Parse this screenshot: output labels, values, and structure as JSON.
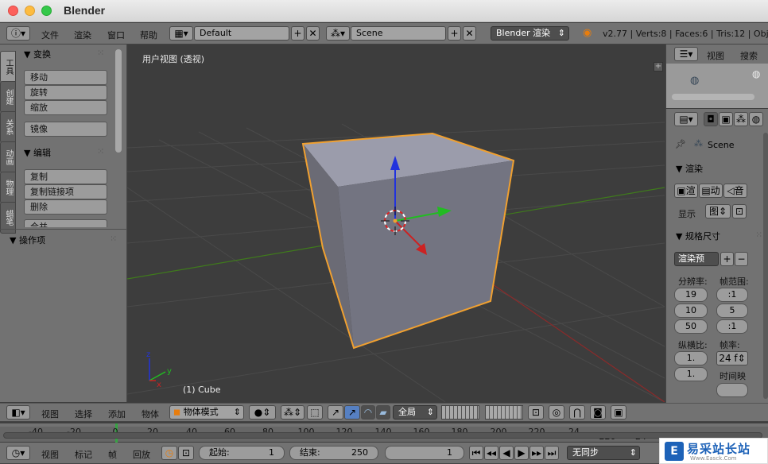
{
  "window": {
    "title": "Blender"
  },
  "info_header": {
    "menus": [
      "文件",
      "渲染",
      "窗口",
      "帮助"
    ],
    "screen_layout": "Default",
    "scene": "Scene",
    "render_engine": "Blender 渲染",
    "stats": "v2.77 | Verts:8 | Faces:6 | Tris:12 | Objec"
  },
  "tool_tabs": [
    "工具",
    "创建",
    "关系",
    "动画",
    "物理",
    "蜡笔"
  ],
  "tool_shelf": {
    "transform": {
      "title": "变换",
      "buttons": [
        "移动",
        "旋转",
        "缩放",
        "镜像"
      ]
    },
    "edit": {
      "title": "编辑",
      "buttons": [
        "复制",
        "复制链接项",
        "删除",
        "合并"
      ]
    },
    "operator": {
      "title": "操作项"
    }
  },
  "viewport": {
    "label": "用户视图 (透视)",
    "object_label": "(1) Cube",
    "axes": {
      "x": "x",
      "y": "y",
      "z": "z"
    }
  },
  "viewport_header": {
    "menus": [
      "视图",
      "选择",
      "添加",
      "物体"
    ],
    "mode": "物体模式",
    "pivot_scope": "全局"
  },
  "outliner": {
    "menus": [
      "视图",
      "搜索"
    ]
  },
  "properties": {
    "scene_name": "Scene",
    "render": {
      "title": "渲染",
      "buttons": [
        "渲",
        "动",
        "音"
      ],
      "display_label": "显示",
      "display_value": "图"
    },
    "dimensions": {
      "title": "规格尺寸",
      "preset": "渲染预",
      "resolution_label": "分辨率:",
      "resolution_values": [
        "19",
        "10",
        "50"
      ],
      "frame_range_label": "帧范围:",
      "frame_range_values": [
        ":1",
        "5",
        ":1"
      ],
      "aspect_label": "纵横比:",
      "aspect_values": [
        "1.",
        "1."
      ],
      "fps_label": "帧率:",
      "fps_value": "24 f",
      "time_remap_label": "时间映"
    }
  },
  "timeline": {
    "ticks": [
      "-40",
      "-20",
      "0",
      "20",
      "40",
      "60",
      "80",
      "100",
      "120",
      "140",
      "160",
      "180",
      "200",
      "220",
      "24",
      "220",
      "24"
    ],
    "menus": [
      "视图",
      "标记",
      "帧",
      "回放"
    ],
    "start_label": "起始:",
    "start_value": "1",
    "end_label": "结束:",
    "end_value": "250",
    "current_frame": "1",
    "sync": "无同步"
  },
  "watermark": {
    "name": "易采站长站",
    "url": "Www.Easck.Com"
  },
  "colors": {
    "viewport_bg": "#3d3d3d",
    "panel_bg": "#727272",
    "selection_outline": "#f0a030",
    "axis_x": "#cc2222",
    "axis_y": "#22bb22",
    "axis_z": "#2233dd",
    "grid_x_line": "#8a2a2a",
    "grid_y_line": "#3f7a1c"
  }
}
